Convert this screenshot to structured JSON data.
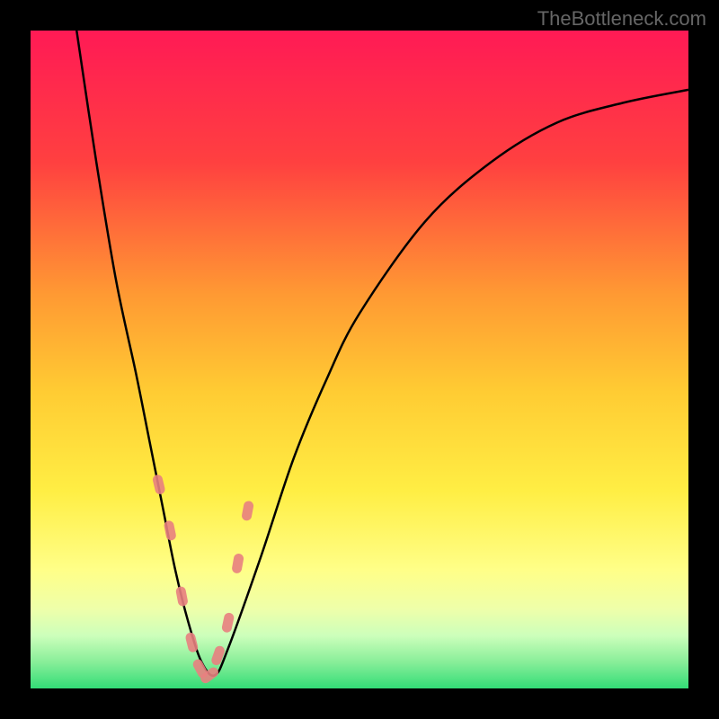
{
  "watermark": "TheBottleneck.com",
  "chart_data": {
    "type": "line",
    "title": "",
    "xlabel": "",
    "ylabel": "",
    "xlim": [
      0,
      100
    ],
    "ylim": [
      0,
      100
    ],
    "background_gradient": {
      "stops": [
        {
          "pos": 0,
          "color": "#ff1a55"
        },
        {
          "pos": 20,
          "color": "#ff4040"
        },
        {
          "pos": 40,
          "color": "#ff9933"
        },
        {
          "pos": 55,
          "color": "#ffcc33"
        },
        {
          "pos": 70,
          "color": "#ffee44"
        },
        {
          "pos": 82,
          "color": "#ffff88"
        },
        {
          "pos": 88,
          "color": "#eeffaa"
        },
        {
          "pos": 92,
          "color": "#ccffbb"
        },
        {
          "pos": 96,
          "color": "#88ee99"
        },
        {
          "pos": 100,
          "color": "#33dd77"
        }
      ]
    },
    "series": [
      {
        "name": "bottleneck-curve",
        "x": [
          7,
          10,
          13,
          16,
          18,
          20,
          22,
          24,
          26,
          28,
          30,
          35,
          40,
          45,
          50,
          60,
          70,
          80,
          90,
          100
        ],
        "y": [
          100,
          80,
          62,
          48,
          38,
          28,
          18,
          10,
          4,
          2,
          6,
          20,
          35,
          47,
          57,
          71,
          80,
          86,
          89,
          91
        ]
      }
    ],
    "markers": {
      "name": "data-points",
      "x": [
        19.5,
        21.2,
        23,
        24.5,
        25.8,
        27.2,
        28.5,
        30,
        31.5,
        33
      ],
      "y": [
        31,
        24,
        14,
        7,
        3,
        2,
        5,
        10,
        19,
        27
      ]
    }
  }
}
